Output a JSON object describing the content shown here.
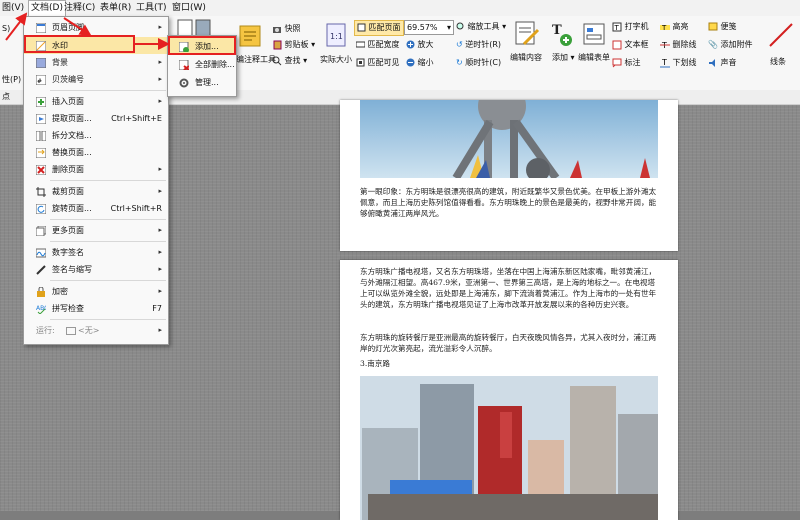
{
  "menubar": {
    "items": [
      "图(V)",
      "文档(D)",
      "注释(C)",
      "表单(R)",
      "工具(T)",
      "窗口(W)"
    ]
  },
  "ribbon": {
    "left_partial": [
      "S)",
      "性(P)"
    ],
    "buttons": {
      "quick": "快照",
      "clipboard": "剪贴板",
      "find": "查找",
      "annot_tool": "编注释工具",
      "actual_size": "实际大小",
      "fit_page": "匹配页面",
      "zoom_value": "69.57%",
      "zoom_tool": "缩放工具",
      "fit_width": "匹配宽度",
      "zoom_in": "放大",
      "rotate_right": "逆时针(R)",
      "fit_visible": "匹配可见",
      "zoom_out": "缩小",
      "rotate_left": "顺时针(C)",
      "edit_content": "编辑内容",
      "add": "添加",
      "edit_form": "编辑表单",
      "typewriter": "打字机",
      "textbox": "文本框",
      "callout": "标注",
      "highlight": "高亮",
      "strikeout": "删除线",
      "underline": "下划线",
      "note": "便笺",
      "attach": "添加附件",
      "sound": "声音",
      "line": "线条"
    }
  },
  "subbar": {
    "left_text": "点"
  },
  "doc_menu": {
    "items": [
      {
        "label": "页眉页脚",
        "arrow": "▸"
      },
      {
        "label": "水印",
        "arrow": "▸"
      },
      {
        "label": "背景",
        "arrow": "▸"
      },
      {
        "label": "贝茨编号",
        "arrow": "▸"
      },
      {
        "label": "插入页面",
        "arrow": "▸"
      },
      {
        "label": "提取页面...",
        "shortcut": "Ctrl+Shift+E"
      },
      {
        "label": "拆分文档..."
      },
      {
        "label": "替换页面..."
      },
      {
        "label": "删除页面",
        "arrow": "▸"
      },
      {
        "label": "裁剪页面",
        "arrow": "▸"
      },
      {
        "label": "旋转页面...",
        "shortcut": "Ctrl+Shift+R"
      },
      {
        "label": "更多页面",
        "arrow": "▸"
      },
      {
        "label": "数字签名",
        "arrow": "▸"
      },
      {
        "label": "签名与缩写",
        "arrow": "▸"
      },
      {
        "label": "加密",
        "arrow": "▸"
      },
      {
        "label": "拼写检查",
        "shortcut": "F7"
      },
      {
        "label": "运行: ",
        "value": "<无>",
        "arrow": "▸"
      }
    ]
  },
  "watermark_submenu": {
    "items": [
      "添加...",
      "全部删除...",
      "管理..."
    ]
  },
  "document": {
    "page1_text": "第一眼印象：东方明珠是很漂亮很高的建筑，附近既繁华又景色优美。在甲板上游外滩太佩意，而且上海历史陈列馆值得看看。东方明珠晚上的景色是最美的，视野非常开阔，能够俯瞰黄浦江两岸风光。",
    "page2_para1": "东方明珠广播电视塔，又名东方明珠塔，坐落在中国上海浦东新区陆家嘴，毗邻黄浦江，与外滩隔江相望。高467.9米，亚洲第一、世界第三高塔，是上海的地标之一。在电视塔上可以纵览外滩全貌，远处即是上海浦东，脚下流淌着黄浦江。作为上海市的一处有世年头的建筑，东方明珠广播电视塔见证了上海市改革开放发展以来的各种历史兴衰。",
    "page2_para2": "东方明珠的旋转餐厅是亚洲最高的旋转餐厅，白天夜晚风情各异，尤其入夜时分，浦江两岸的灯光次第亮起，流光溢彩令人沉醉。",
    "page2_heading": "3.南京路"
  }
}
